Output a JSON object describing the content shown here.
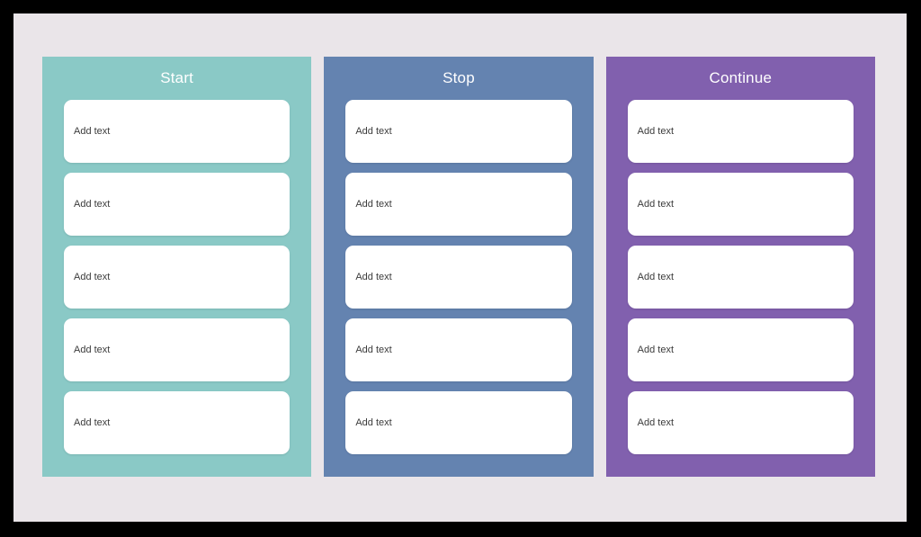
{
  "board": {
    "canvas_background": "#EAE5E9",
    "frame_background": "#000000",
    "card_background": "#FFFFFF",
    "card_text_color": "#3B3B3B",
    "title_color": "#FFFFFF",
    "columns": [
      {
        "title": "Start",
        "color": "#8AC9C6",
        "cards": [
          {
            "text": "Add text"
          },
          {
            "text": "Add text"
          },
          {
            "text": "Add text"
          },
          {
            "text": "Add text"
          },
          {
            "text": "Add text"
          }
        ]
      },
      {
        "title": "Stop",
        "color": "#6483B0",
        "cards": [
          {
            "text": "Add text"
          },
          {
            "text": "Add text"
          },
          {
            "text": "Add text"
          },
          {
            "text": "Add text"
          },
          {
            "text": "Add text"
          }
        ]
      },
      {
        "title": "Continue",
        "color": "#8160AE",
        "cards": [
          {
            "text": "Add text"
          },
          {
            "text": "Add text"
          },
          {
            "text": "Add text"
          },
          {
            "text": "Add text"
          },
          {
            "text": "Add text"
          }
        ]
      }
    ]
  }
}
